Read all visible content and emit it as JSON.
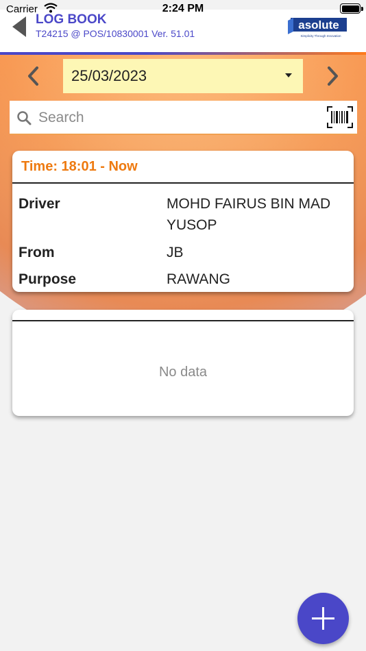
{
  "status_bar": {
    "carrier": "Carrier",
    "time": "2:24 PM"
  },
  "header": {
    "title": "LOG BOOK",
    "subtitle": "T24215 @ POS/10830001 Ver. 51.01",
    "logo_text": "asolute",
    "logo_tagline": "Simplicity Through Innovation"
  },
  "date_picker": {
    "value": "25/03/2023"
  },
  "search": {
    "placeholder": "Search",
    "value": ""
  },
  "log_card": {
    "time": "Time: 18:01 - Now",
    "rows": [
      {
        "label": "Driver",
        "value": "MOHD FAIRUS BIN MAD YUSOP"
      },
      {
        "label": "From",
        "value": "JB"
      },
      {
        "label": "Purpose",
        "value": "RAWANG"
      }
    ]
  },
  "empty_card": {
    "message": "No data"
  },
  "colors": {
    "accent": "#4a47c8",
    "orange": "#ee7a10",
    "date_bg": "#fdf7b5"
  },
  "icons": [
    "back-icon",
    "chevron-left-icon",
    "chevron-right-icon",
    "search-icon",
    "barcode-icon",
    "plus-icon"
  ]
}
